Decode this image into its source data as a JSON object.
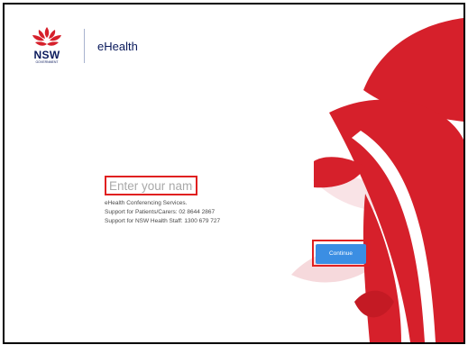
{
  "brand": {
    "logo_text": "NSW",
    "logo_subtext": "GOVERNMENT",
    "app_name": "eHealth",
    "primary_color": "#d6202b",
    "navy_color": "#0a1a5c",
    "light_petal_color": "#f7dde0"
  },
  "login": {
    "name_placeholder": "Enter your name",
    "name_value": "",
    "info_lines": [
      "eHealth Conferencing Services.",
      "Support for Patients/Carers: 02 8644 2867",
      "Support for NSW Health Staff: 1300 679 727"
    ],
    "continue_label": "Continue",
    "continue_color": "#3b8ee3"
  }
}
